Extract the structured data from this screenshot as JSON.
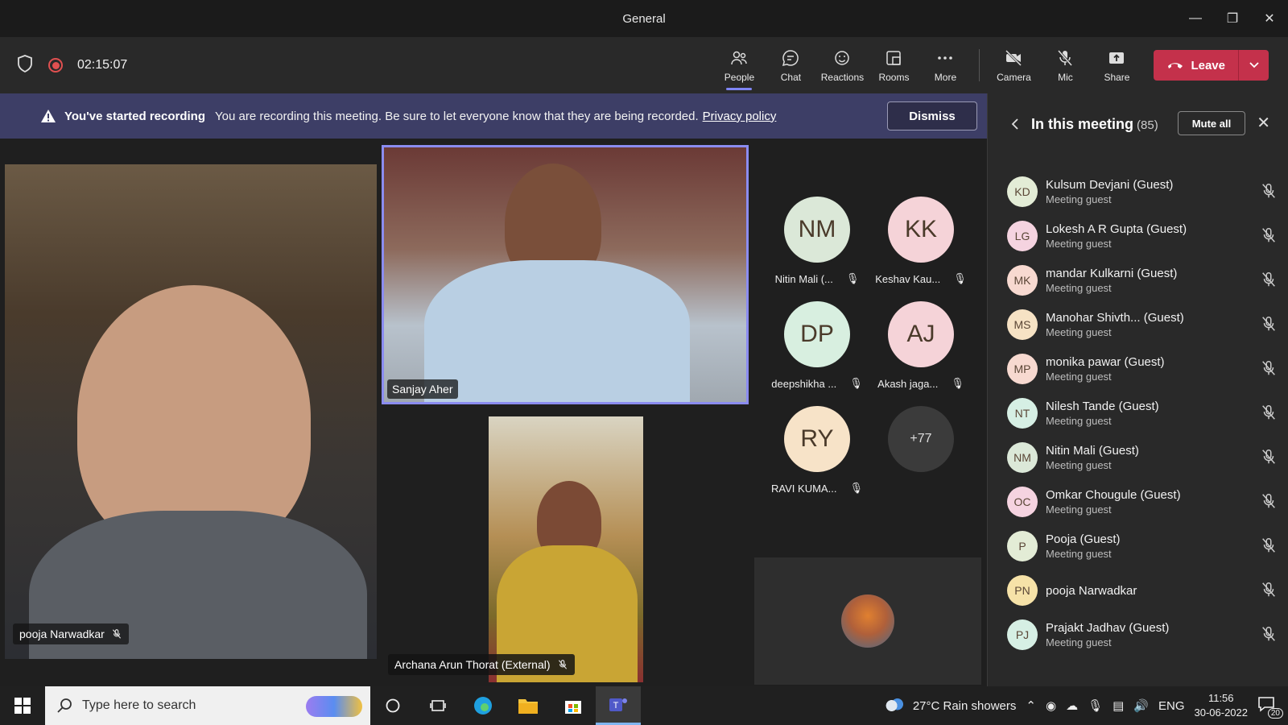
{
  "window": {
    "title": "General"
  },
  "toolbar": {
    "timer": "02:15:07",
    "buttons": [
      {
        "label": "People",
        "icon": "people-icon"
      },
      {
        "label": "Chat",
        "icon": "chat-icon"
      },
      {
        "label": "Reactions",
        "icon": "reactions-icon"
      },
      {
        "label": "Rooms",
        "icon": "rooms-icon"
      },
      {
        "label": "More",
        "icon": "more-icon"
      },
      {
        "label": "Camera",
        "icon": "camera-off-icon"
      },
      {
        "label": "Mic",
        "icon": "mic-off-icon"
      },
      {
        "label": "Share",
        "icon": "share-icon"
      }
    ],
    "leave_label": "Leave"
  },
  "banner": {
    "title": "You've started recording",
    "text": "You are recording this meeting. Be sure to let everyone know that they are being recorded.",
    "link": "Privacy policy",
    "dismiss_label": "Dismiss"
  },
  "stage": {
    "videos": [
      {
        "name": "pooja Narwadkar"
      },
      {
        "name": "Sanjay Aher"
      },
      {
        "name": "Archana Arun Thorat (External)"
      }
    ],
    "tiles": [
      {
        "initials": "NM",
        "name": "Nitin Mali (...",
        "color": "#dbe8d8"
      },
      {
        "initials": "KK",
        "name": "Keshav Kau...",
        "color": "#f5d3d8"
      },
      {
        "initials": "DP",
        "name": "deepshikha ...",
        "color": "#d8efe0"
      },
      {
        "initials": "AJ",
        "name": "Akash jaga...",
        "color": "#f5d3d8"
      },
      {
        "initials": "RY",
        "name": "RAVI KUMA...",
        "color": "#f7e3c8"
      }
    ],
    "overflow_count": "+77"
  },
  "panel": {
    "title": "In this meeting",
    "count": "(85)",
    "mute_all_label": "Mute all",
    "participants": [
      {
        "initials": "KD",
        "name": "Kulsum Devjani (Guest)",
        "role": "Meeting guest",
        "color": "#e3ecd6"
      },
      {
        "initials": "LG",
        "name": "Lokesh A R Gupta (Guest)",
        "role": "Meeting guest",
        "color": "#f5d3e0"
      },
      {
        "initials": "MK",
        "name": "mandar Kulkarni (Guest)",
        "role": "Meeting guest",
        "color": "#f7d9d0"
      },
      {
        "initials": "MS",
        "name": "Manohar Shivth...  (Guest)",
        "role": "Meeting guest",
        "color": "#f6e2c4"
      },
      {
        "initials": "MP",
        "name": "monika pawar (Guest)",
        "role": "Meeting guest",
        "color": "#f7d9d0"
      },
      {
        "initials": "NT",
        "name": "Nilesh Tande (Guest)",
        "role": "Meeting guest",
        "color": "#d6efe4"
      },
      {
        "initials": "NM",
        "name": "Nitin Mali (Guest)",
        "role": "Meeting guest",
        "color": "#dbe8d8"
      },
      {
        "initials": "OC",
        "name": "Omkar Chougule (Guest)",
        "role": "Meeting guest",
        "color": "#f5d3e0"
      },
      {
        "initials": "P",
        "name": "Pooja (Guest)",
        "role": "Meeting guest",
        "color": "#e3ecd6"
      },
      {
        "initials": "PN",
        "name": "pooja Narwadkar",
        "role": "",
        "color": "#f6e2a8"
      },
      {
        "initials": "PJ",
        "name": "Prajakt Jadhav (Guest)",
        "role": "Meeting guest",
        "color": "#d6efe4"
      }
    ]
  },
  "taskbar": {
    "search_placeholder": "Type here to search",
    "weather": "27°C  Rain showers",
    "language": "ENG",
    "time": "11:56",
    "date": "30-06-2022",
    "notification_count": "20"
  }
}
